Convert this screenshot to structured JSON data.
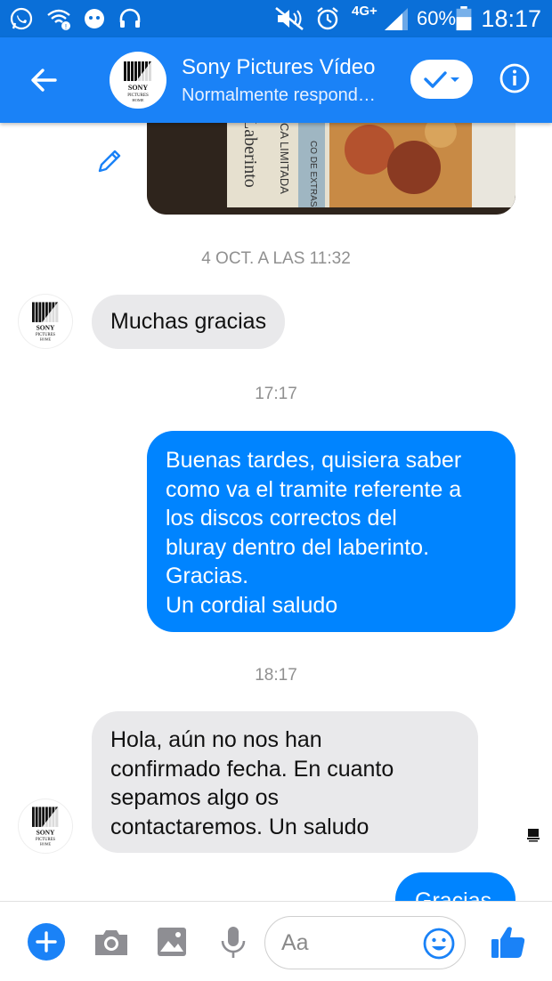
{
  "status_bar": {
    "battery_text": "60%",
    "time": "18:17",
    "network": "4G+",
    "icons": [
      "whatsapp-icon",
      "wifi-alert-icon",
      "game-controller-icon",
      "headset-icon",
      "mute-icon",
      "alarm-icon",
      "signal-icon",
      "battery-icon"
    ]
  },
  "header": {
    "title": "Sony Pictures Vídeo",
    "subtitle": "Normalmente respond…",
    "avatar_logo_text": "SONY PICTURES HOME"
  },
  "chat": {
    "messages": [
      {
        "type": "timestamp",
        "text": "4 OCT. A LAS 11:32"
      },
      {
        "type": "incoming",
        "text": "Muchas gracias"
      },
      {
        "type": "timestamp",
        "text": "17:17"
      },
      {
        "type": "outgoing",
        "text": "Buenas tardes, quisiera saber\ncomo va el tramite referente  a\nlos discos  correctos del\nbluray dentro del laberinto.\nGracias.\nUn cordial saludo"
      },
      {
        "type": "timestamp",
        "text": "18:17"
      },
      {
        "type": "incoming",
        "text": "Hola, aún no nos han\nconfirmado fecha. En cuanto\nsepamos algo os\ncontactaremos. Un saludo"
      },
      {
        "type": "outgoing",
        "text": "Gracias"
      }
    ],
    "photo_text": [
      "CO DE EXTRAS",
      "CA LIMITADA",
      "Laberinto"
    ]
  },
  "composer": {
    "placeholder": "Aa"
  },
  "colors": {
    "header_blue": "#1a82f7",
    "statusbar_blue": "#0a6fd8",
    "outgoing_bubble": "#0084ff",
    "incoming_bubble": "#e9e9eb"
  }
}
